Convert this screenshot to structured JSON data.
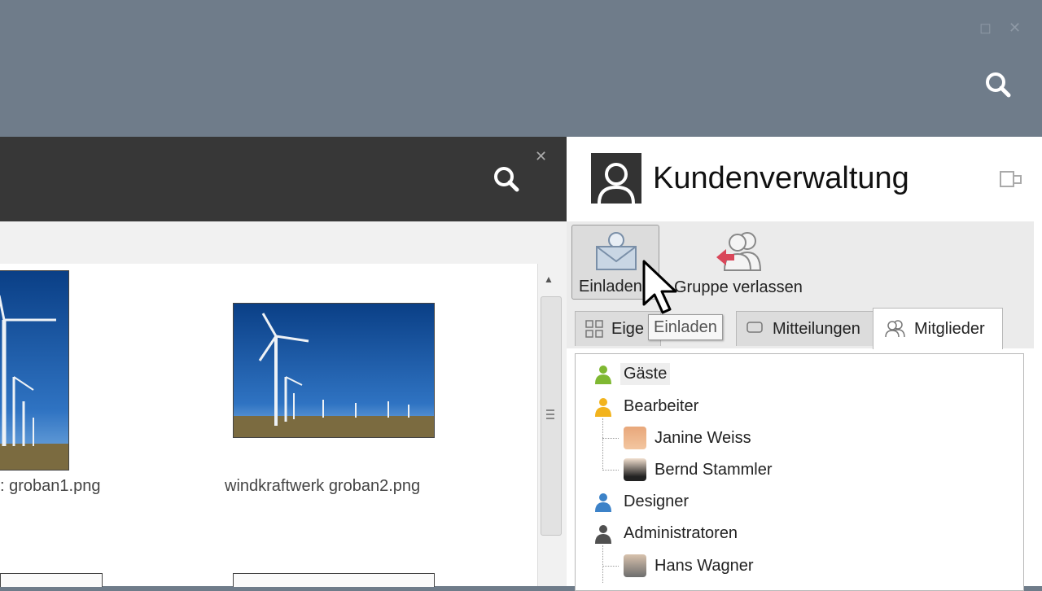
{
  "window": {
    "restore_symbol": "◻",
    "close_symbol": "✕",
    "search_icon": "search-icon"
  },
  "files": {
    "items": [
      {
        "caption": ": groban1.png"
      },
      {
        "caption": "windkraftwerk groban2.png"
      }
    ]
  },
  "panel": {
    "title": "Kundenverwaltung",
    "ribbon": {
      "invite_label": "Einladen",
      "leave_label": "Gruppe verlassen"
    },
    "tooltip": "Einladen",
    "tabs": [
      {
        "label": "Eige"
      },
      {
        "label": "Mitteilungen"
      },
      {
        "label": "Mitglieder"
      }
    ],
    "tree": {
      "guests": "Gäste",
      "editors": "Bearbeiter",
      "editor_members": [
        "Janine Weiss",
        "Bernd Stammler"
      ],
      "designers": "Designer",
      "admins": "Administratoren",
      "admin_members": [
        "Hans Wagner"
      ]
    },
    "colors": {
      "guest": "#7fb832",
      "editor": "#f2b31d",
      "designer": "#3c82c8",
      "admin": "#505050"
    }
  }
}
